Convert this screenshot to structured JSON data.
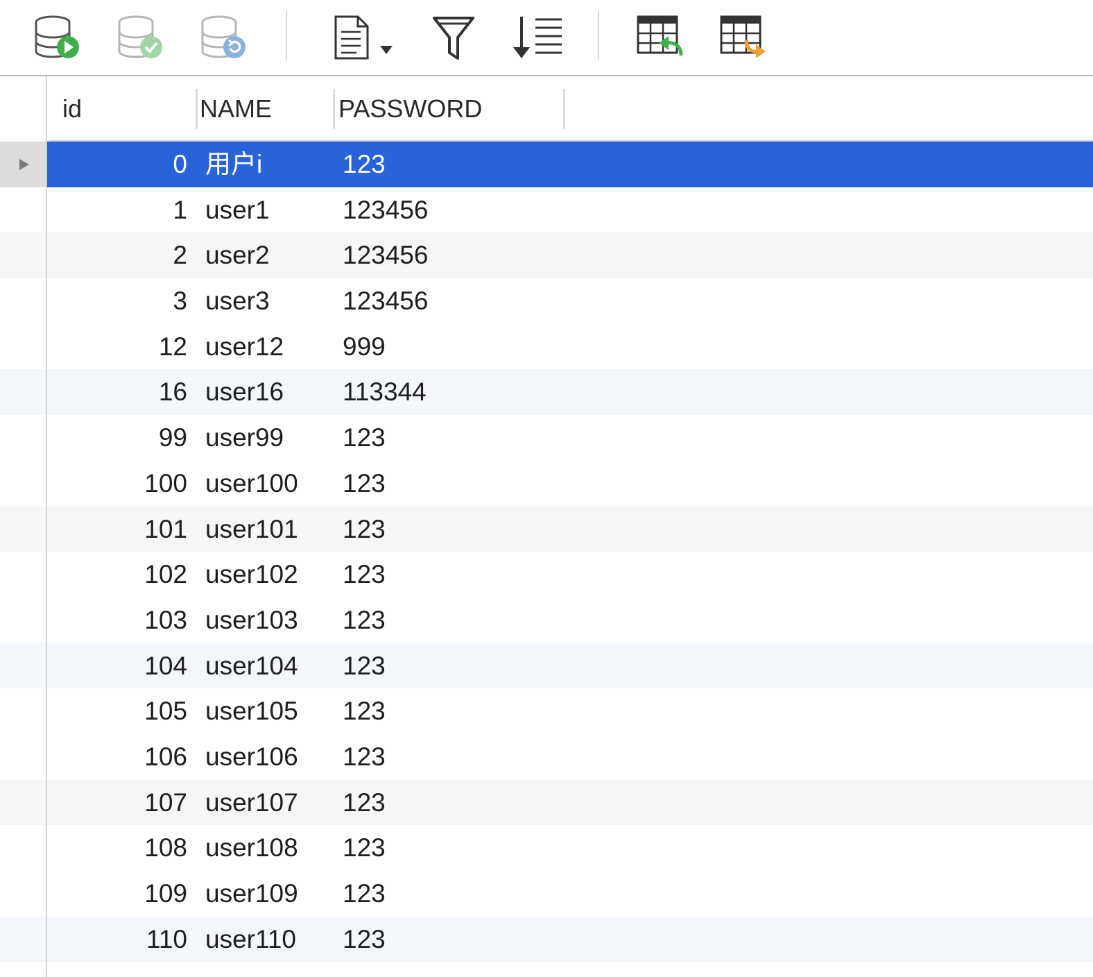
{
  "toolbar": {
    "buttons": [
      {
        "name": "execute-query-icon"
      },
      {
        "name": "commit-icon"
      },
      {
        "name": "rollback-icon"
      },
      {
        "name": "document-dropdown-icon"
      },
      {
        "name": "filter-icon"
      },
      {
        "name": "sort-icon"
      },
      {
        "name": "import-table-icon"
      },
      {
        "name": "export-table-icon"
      }
    ],
    "colors": {
      "green": "#3fb04a",
      "blue": "#8ab2e0",
      "orange": "#f0a030"
    }
  },
  "table": {
    "columns": [
      "id",
      "NAME",
      "PASSWORD"
    ],
    "selected_color": "#2963d9",
    "rows": [
      {
        "id": "0",
        "name": "用户i",
        "password": "123"
      },
      {
        "id": "1",
        "name": "user1",
        "password": "123456"
      },
      {
        "id": "2",
        "name": "user2",
        "password": "123456"
      },
      {
        "id": "3",
        "name": "user3",
        "password": "123456"
      },
      {
        "id": "12",
        "name": "user12",
        "password": "999"
      },
      {
        "id": "16",
        "name": "user16",
        "password": "113344"
      },
      {
        "id": "99",
        "name": "user99",
        "password": "123"
      },
      {
        "id": "100",
        "name": "user100",
        "password": "123"
      },
      {
        "id": "101",
        "name": "user101",
        "password": "123"
      },
      {
        "id": "102",
        "name": "user102",
        "password": "123"
      },
      {
        "id": "103",
        "name": "user103",
        "password": "123"
      },
      {
        "id": "104",
        "name": "user104",
        "password": "123"
      },
      {
        "id": "105",
        "name": "user105",
        "password": "123"
      },
      {
        "id": "106",
        "name": "user106",
        "password": "123"
      },
      {
        "id": "107",
        "name": "user107",
        "password": "123"
      },
      {
        "id": "108",
        "name": "user108",
        "password": "123"
      },
      {
        "id": "109",
        "name": "user109",
        "password": "123"
      },
      {
        "id": "110",
        "name": "user110",
        "password": "123"
      }
    ]
  }
}
